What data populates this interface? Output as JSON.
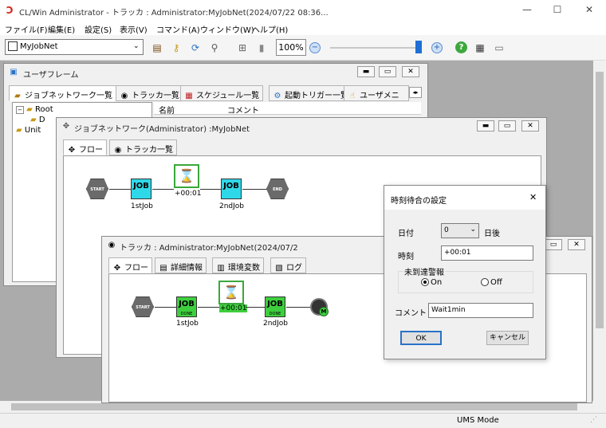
{
  "app": {
    "title": "CL/Win                                     Administrator - トラッカ :                                     Administrator:MyJobNet(2024/07/22 08:36...",
    "window_buttons": {
      "minimize": "—",
      "maximize": "☐",
      "close": "✕"
    }
  },
  "menu": [
    "ファイル(F)",
    "編集(E)",
    "設定(S)",
    "表示(V)",
    "コマンド(A)",
    "ウィンドウ(W)",
    "ヘルプ(H)"
  ],
  "toolbar": {
    "jobnet_select": "MyJobNet",
    "zoom": "100%",
    "zoom_out": "−",
    "zoom_in": "+",
    "zoom_level_fraction": 0.98,
    "icons": [
      "open-jobnet-icon",
      "key-icon",
      "refresh-icon",
      "search-icon",
      "fit-icon",
      "page-icon",
      "zoom-out-icon",
      "zoom-in-icon",
      "help-icon",
      "calendar-icon",
      "save-icon"
    ],
    "help": "?"
  },
  "user_frame": {
    "title": "ユーザフレーム",
    "tabs": [
      "ジョブネットワーク一覧",
      "トラッカ一覧",
      "スケジュール一覧",
      "起動トリガー一覧",
      "ユーザメニ"
    ],
    "tree": [
      "Root",
      "D",
      "Unit"
    ],
    "columns": [
      "名前",
      "コメント"
    ]
  },
  "jobnet_window": {
    "title": "ジョブネットワーク(Administrator) :MyJobNet",
    "tabs": [
      "フロー",
      "トラッカ一覧"
    ],
    "nodes": {
      "start": "START",
      "end": "END",
      "job1": "1stJob",
      "job2": "2ndJob",
      "wait": "+00:01"
    }
  },
  "tracker_window": {
    "title": "トラッカ :                                       Administrator:MyJobNet(2024/07/2",
    "tabs": [
      "フロー",
      "詳細情報",
      "環境変数",
      "ログ"
    ],
    "nodes": {
      "start": "START",
      "job1": "1stJob",
      "job2": "2ndJob",
      "wait": "+00:01",
      "done": "DONE"
    }
  },
  "job_glyph": "JOB",
  "dialog": {
    "title": "時刻待合の設定",
    "close": "✕",
    "date_label": "日付",
    "date_value": "0",
    "date_suffix": "日後",
    "time_label": "時刻",
    "time_value": "+00:01",
    "alarm_group": "未到達警報",
    "on_label": "On",
    "off_label": "Off",
    "comment_label": "コメント",
    "comment_value": "Wait1min",
    "ok": "OK",
    "cancel": "キャンセル"
  },
  "status": {
    "mode": "UMS Mode"
  },
  "colors": {
    "job_ready": "#2fd8e8",
    "job_done": "#3ecf3e",
    "wait_border": "#3aa83a",
    "slider": "#1f6fd6"
  }
}
